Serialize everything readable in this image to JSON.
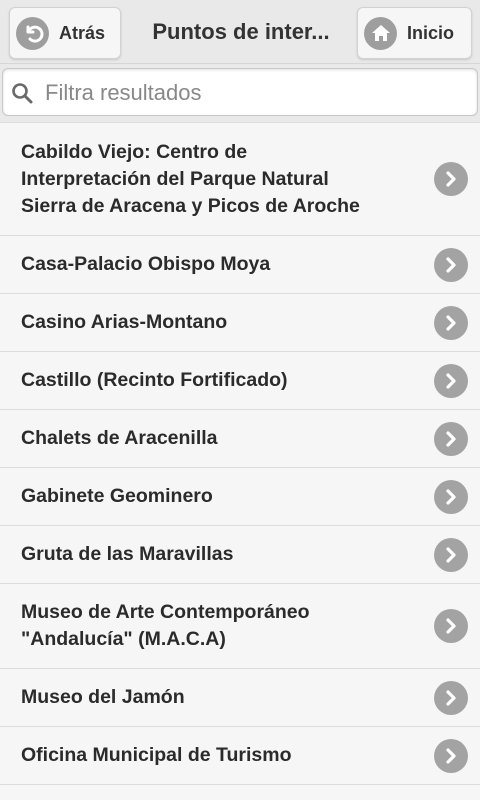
{
  "header": {
    "title": "Puntos de inter...",
    "back_label": "Atrás",
    "home_label": "Inicio"
  },
  "search": {
    "placeholder": "Filtra resultados",
    "value": ""
  },
  "list": {
    "items": [
      {
        "label": "Cabildo Viejo: Centro de\nInterpretación del Parque Natural\nSierra de Aracena y Picos de Aroche"
      },
      {
        "label": "Casa-Palacio Obispo Moya"
      },
      {
        "label": "Casino Arias-Montano"
      },
      {
        "label": "Castillo (Recinto Fortificado)"
      },
      {
        "label": "Chalets de Aracenilla"
      },
      {
        "label": "Gabinete Geominero"
      },
      {
        "label": "Gruta de las Maravillas"
      },
      {
        "label": "Museo de Arte Contemporáneo\n\"Andalucía\" (M.A.C.A)"
      },
      {
        "label": "Museo del Jamón"
      },
      {
        "label": "Oficina Municipal de Turismo"
      }
    ]
  },
  "icons": {
    "back": "back-arrow-icon",
    "home": "home-icon",
    "search": "search-icon",
    "item_arrow": "chevron-right-icon"
  }
}
